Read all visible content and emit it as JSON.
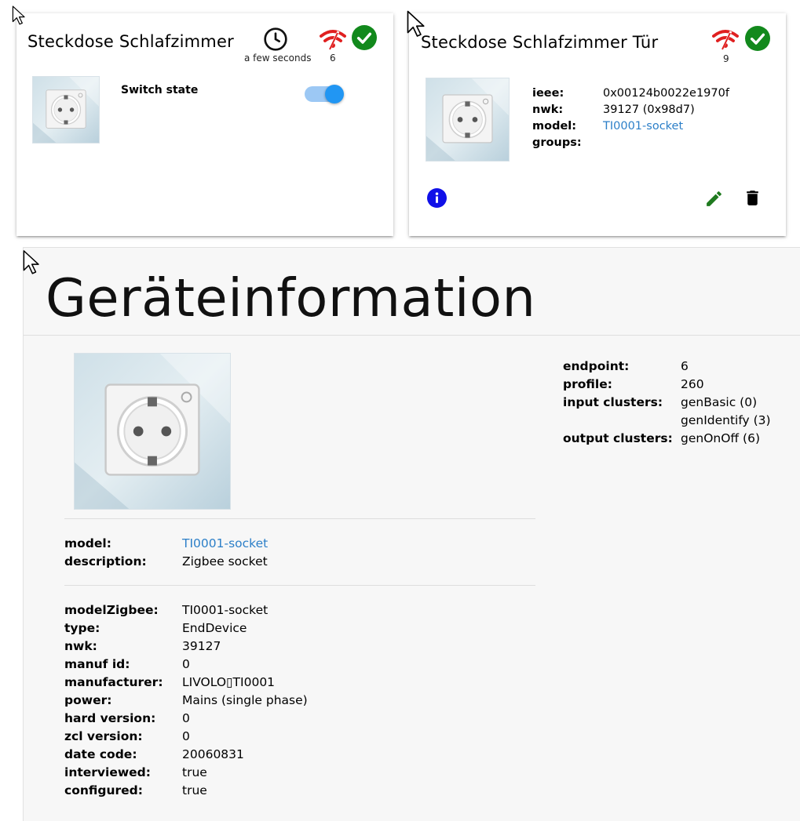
{
  "card1": {
    "title": "Steckdose Schlafzimmer",
    "last_seen": "a few seconds",
    "link_quality": "6",
    "switch_label": "Switch state",
    "switch_on": true
  },
  "card2": {
    "title": "Steckdose Schlafzimmer Tür",
    "link_quality": "9",
    "info": [
      {
        "key": "ieee:",
        "value": "0x00124b0022e1970f"
      },
      {
        "key": "nwk:",
        "value": "39127 (0x98d7)"
      },
      {
        "key": "model:",
        "value": "TI0001-socket"
      },
      {
        "key": "groups:",
        "value": ""
      }
    ]
  },
  "panel": {
    "title": "Geräteinformation",
    "model_section": [
      {
        "key": "model:",
        "value": "TI0001-socket"
      },
      {
        "key": "description:",
        "value": "Zigbee socket"
      }
    ],
    "details": [
      {
        "key": "modelZigbee:",
        "value": "TI0001-socket"
      },
      {
        "key": "type:",
        "value": "EndDevice"
      },
      {
        "key": "nwk:",
        "value": "39127"
      },
      {
        "key": "manuf id:",
        "value": "0"
      },
      {
        "key": "manufacturer:",
        "value": "LIVOLO▯TI0001"
      },
      {
        "key": "power:",
        "value": "Mains (single phase)"
      },
      {
        "key": "hard version:",
        "value": "0"
      },
      {
        "key": "zcl version:",
        "value": "0"
      },
      {
        "key": "date code:",
        "value": "20060831"
      },
      {
        "key": "interviewed:",
        "value": "true"
      },
      {
        "key": "configured:",
        "value": "true"
      }
    ],
    "endpoint": [
      {
        "key": "endpoint:",
        "value": "6"
      },
      {
        "key": "profile:",
        "value": "260"
      },
      {
        "key": "input clusters:",
        "value": "genBasic (0)"
      },
      {
        "key": "",
        "value": "genIdentify (3)"
      },
      {
        "key": "output clusters:",
        "value": "genOnOff (6)"
      }
    ]
  },
  "colors": {
    "signal": "#e02020",
    "ok": "#12891c",
    "info": "#1010e8",
    "edit": "#1f7a1f",
    "link": "#2c7fc8",
    "toggle": "#2196f3"
  },
  "icons": [
    "clock-icon",
    "signal-icon",
    "check-circle-icon",
    "info-icon",
    "edit-icon",
    "delete-icon",
    "cursor-icon"
  ]
}
